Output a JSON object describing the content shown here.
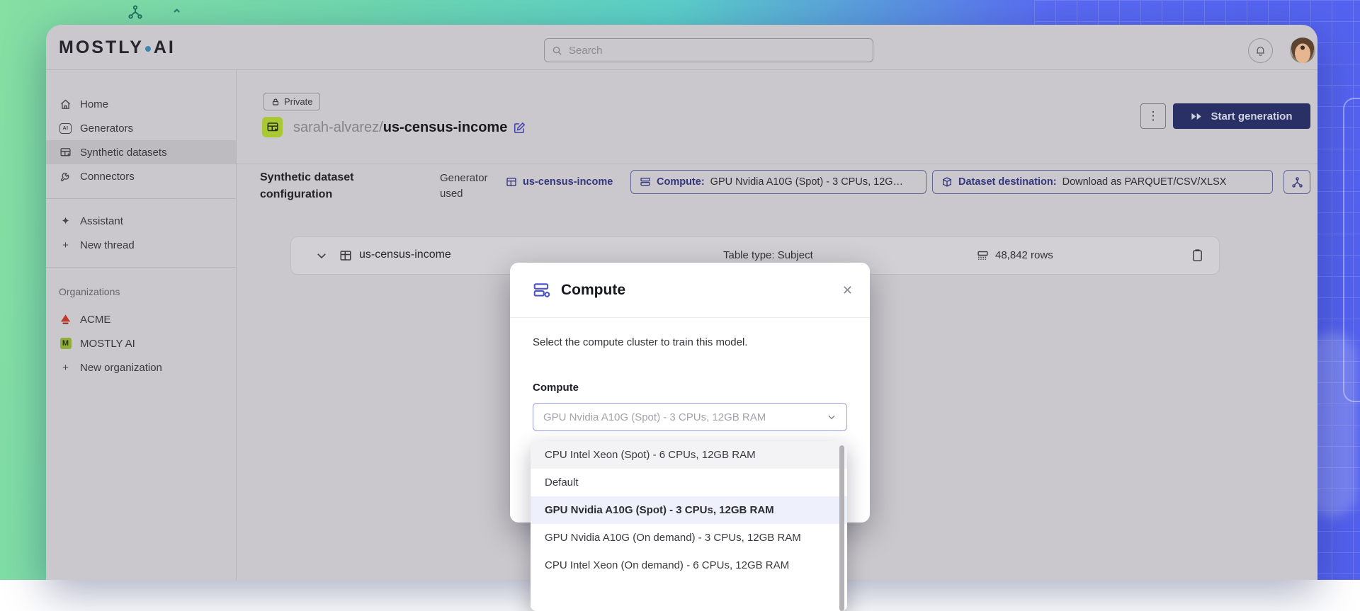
{
  "colors": {
    "accent_indigo": "#34377f",
    "brand_navy": "#293066",
    "lime_icon": "#a9c832",
    "bg_green": "#7edba5",
    "bg_blue": "#5a66f2",
    "select_focus_border": "#99a0ea",
    "selected_option_bg": "#eef1fc"
  },
  "topbar": {
    "logo_main": "MOSTLY",
    "logo_suffix": "AI",
    "search_placeholder": "Search"
  },
  "sidebar": {
    "items": [
      {
        "label": "Home"
      },
      {
        "label": "Generators"
      },
      {
        "label": "Synthetic datasets",
        "active": true
      },
      {
        "label": "Connectors"
      }
    ],
    "thread_items": [
      {
        "label": "Assistant"
      },
      {
        "label": "New thread"
      }
    ],
    "organizations_label": "Organizations",
    "organizations": [
      {
        "label": "ACME"
      },
      {
        "label": "MOSTLY AI"
      }
    ],
    "new_organization": "New organization"
  },
  "page": {
    "badge": "Private",
    "breadcrumb": {
      "owner": "sarah-alvarez/",
      "name": "us-census-income"
    },
    "start_generation": "Start generation",
    "section_title": "Synthetic dataset configuration",
    "generator_used": "Generator used",
    "chips": {
      "generator": "us-census-income",
      "compute_prefix": "Compute:",
      "compute_value": "GPU Nvidia A10G (Spot) - 3 CPUs, 12G…",
      "destination_prefix": "Dataset destination:",
      "destination_value": "Download as PARQUET/CSV/XLSX"
    },
    "table_row": {
      "name": "us-census-income",
      "type": "Table type: Subject",
      "rows": "48,842 rows"
    }
  },
  "modal": {
    "title": "Compute",
    "description": "Select the compute cluster to train this model.",
    "label": "Compute",
    "value": "GPU Nvidia A10G (Spot) - 3 CPUs, 12GB RAM",
    "options": [
      {
        "label": "CPU Intel Xeon (Spot) - 6 CPUs, 12GB RAM"
      },
      {
        "label": "Default"
      },
      {
        "label": "GPU Nvidia A10G (Spot) - 3 CPUs, 12GB RAM"
      },
      {
        "label": "GPU Nvidia A10G (On demand) - 3 CPUs, 12GB RAM"
      },
      {
        "label": "CPU Intel Xeon (On demand) - 6 CPUs, 12GB RAM"
      }
    ]
  },
  "glyphs": {
    "kebab": "⋮",
    "close": "✕",
    "plus": "+",
    "sparkle": "✦",
    "caret": "⌃"
  }
}
